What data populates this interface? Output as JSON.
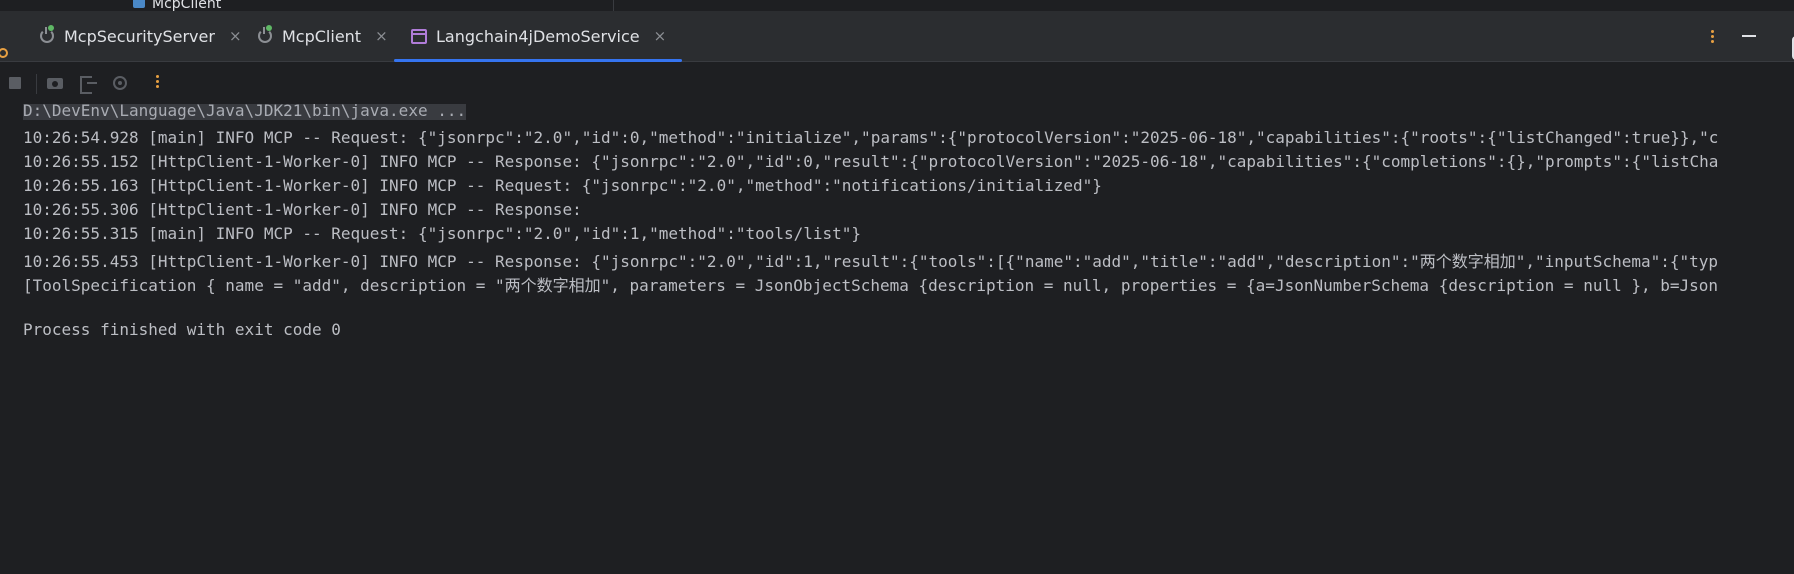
{
  "top": {
    "crumb": "McpClient"
  },
  "tabs": [
    {
      "label": "McpSecurityServer",
      "close": "×"
    },
    {
      "label": "McpClient",
      "close": "×"
    },
    {
      "label": "Langchain4jDemoService",
      "close": "×"
    }
  ],
  "colors": {
    "accent": "#3574f0",
    "run_green": "#5fb865",
    "kebab": "#e8a042",
    "bg": "#1e1f22"
  },
  "icons": [
    "power-icon",
    "window-icon",
    "more-icon",
    "minimize-icon",
    "stop-icon",
    "camera-icon",
    "exit-icon",
    "settings-icon"
  ],
  "console": {
    "lines": [
      "D:\\DevEnv\\Language\\Java\\JDK21\\bin\\java.exe ...",
      "10:26:54.928 [main] INFO MCP -- Request: {\"jsonrpc\":\"2.0\",\"id\":0,\"method\":\"initialize\",\"params\":{\"protocolVersion\":\"2025-06-18\",\"capabilities\":{\"roots\":{\"listChanged\":true}},\"c",
      "10:26:55.152 [HttpClient-1-Worker-0] INFO MCP -- Response: {\"jsonrpc\":\"2.0\",\"id\":0,\"result\":{\"protocolVersion\":\"2025-06-18\",\"capabilities\":{\"completions\":{},\"prompts\":{\"listCha",
      "10:26:55.163 [HttpClient-1-Worker-0] INFO MCP -- Request: {\"jsonrpc\":\"2.0\",\"method\":\"notifications/initialized\"}",
      "10:26:55.306 [HttpClient-1-Worker-0] INFO MCP -- Response:",
      "10:26:55.315 [main] INFO MCP -- Request: {\"jsonrpc\":\"2.0\",\"id\":1,\"method\":\"tools/list\"}",
      "10:26:55.453 [HttpClient-1-Worker-0] INFO MCP -- Response: {\"jsonrpc\":\"2.0\",\"id\":1,\"result\":{\"tools\":[{\"name\":\"add\",\"title\":\"add\",\"description\":\"两个数字相加\",\"inputSchema\":{\"typ",
      "[ToolSpecification { name = \"add\", description = \"两个数字相加\", parameters = JsonObjectSchema {description = null, properties = {a=JsonNumberSchema {description = null }, b=Json",
      "",
      "Process finished with exit code 0"
    ]
  }
}
